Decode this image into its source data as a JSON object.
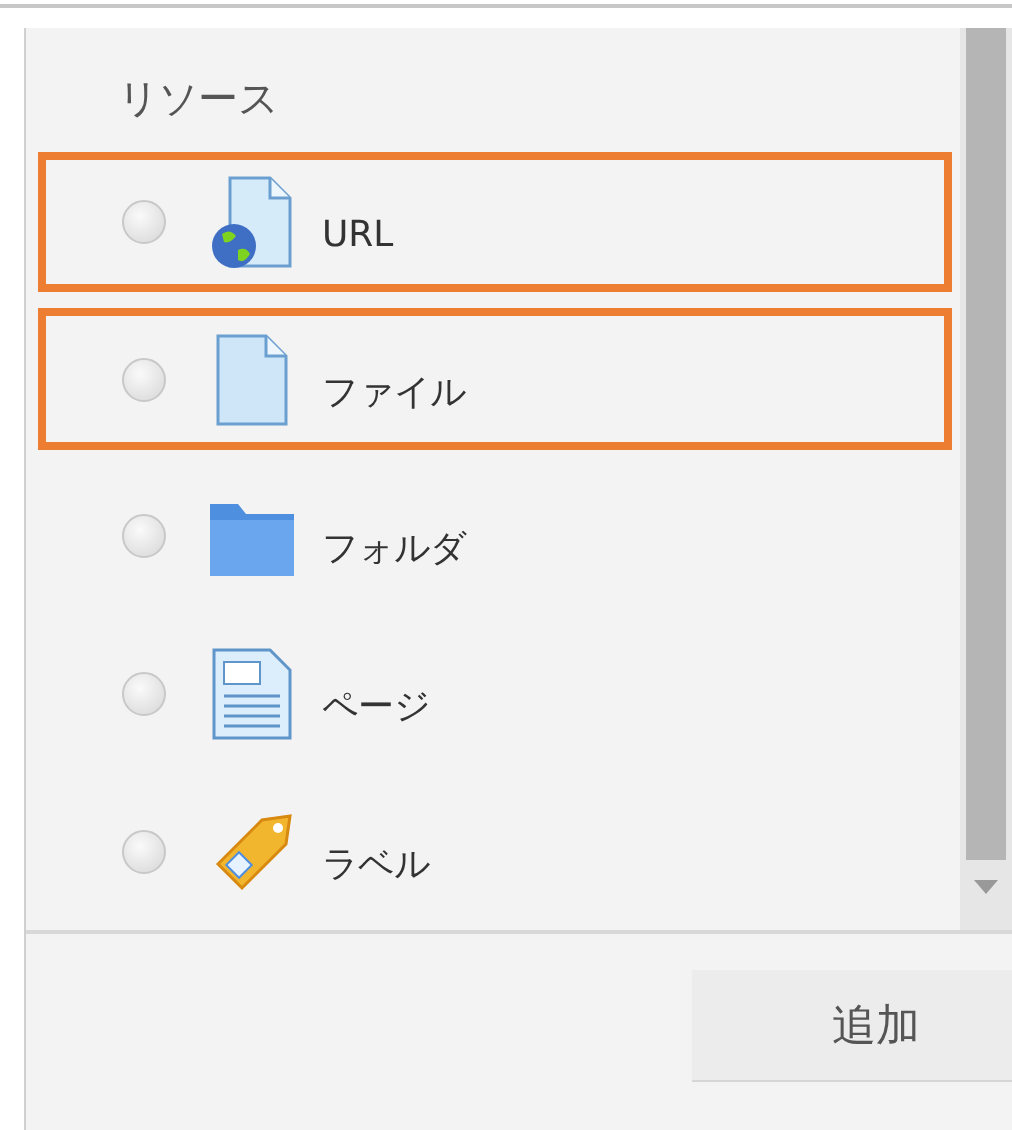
{
  "section": {
    "title": "リソース"
  },
  "items": [
    {
      "kind": "url",
      "label": "URL",
      "selected": false,
      "highlighted": true
    },
    {
      "kind": "file",
      "label": "ファイル",
      "selected": false,
      "highlighted": true
    },
    {
      "kind": "folder",
      "label": "フォルダ",
      "selected": false,
      "highlighted": false
    },
    {
      "kind": "page",
      "label": "ページ",
      "selected": false,
      "highlighted": false
    },
    {
      "kind": "label",
      "label": "ラベル",
      "selected": false,
      "highlighted": false
    }
  ],
  "buttons": [
    {
      "label": "追加"
    }
  ]
}
